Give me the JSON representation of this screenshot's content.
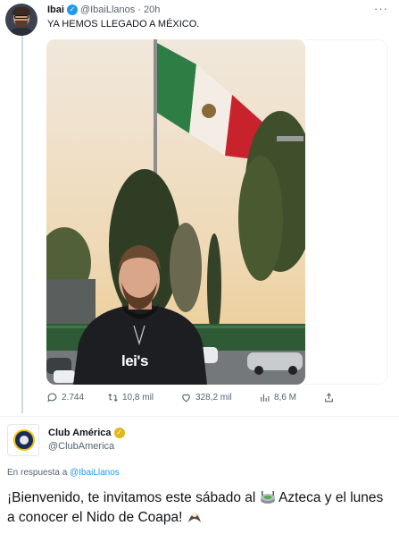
{
  "tweet": {
    "author_name": "Ibai",
    "author_handle": "@IbaiLlanos",
    "separator": "·",
    "time": "20h",
    "text": "YA HEMOS LLEGADO A MÉXICO.",
    "photo_text": "lei's",
    "stats": {
      "replies": "2.744",
      "retweets": "10,8 mil",
      "likes": "328,2 mil",
      "views": "8,6 M"
    }
  },
  "reply": {
    "author_name": "Club América",
    "author_handle": "@ClubAmerica",
    "reply_prefix": "En respuesta a",
    "reply_mention": "@IbaiLlanos",
    "text_part1": "¡Bienvenido, te invitamos este sábado al",
    "text_part2": "Azteca y el lunes a conocer el Nido de Coapa!",
    "emoji_1": "stadium-icon",
    "emoji_2": "eagle-icon"
  },
  "colors": {
    "verified_blue": "#1d9bf0",
    "verified_gold": "#e2b719",
    "muted_text": "#536471",
    "link": "#1d9bf0"
  }
}
